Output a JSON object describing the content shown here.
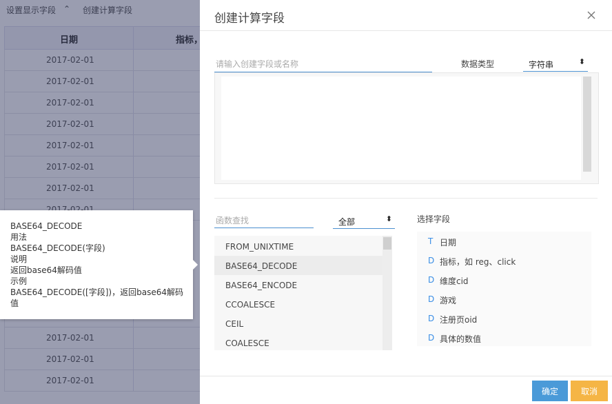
{
  "background": {
    "toolbar": {
      "display_fields": "设置显示字段",
      "chevron": "⌃",
      "create_field": "创建计算字段"
    },
    "table": {
      "headers": [
        "日期",
        "指标，"
      ],
      "rows_top": [
        "2017-02-01",
        "2017-02-01",
        "2017-02-01",
        "2017-02-01",
        "2017-02-01",
        "2017-02-01",
        "2017-02-01",
        "2017-02-01"
      ],
      "rows_bottom": [
        "2017-02-01",
        "2017-02-01",
        "2017-02-01",
        "2017-02-01"
      ]
    }
  },
  "tooltip": {
    "lines": [
      "BASE64_DECODE",
      "用法",
      "BASE64_DECODE(字段)",
      "说明",
      "返回base64解码值",
      "示例",
      "BASE64_DECODE([字段])，返回base64解码",
      "值"
    ]
  },
  "dialog": {
    "title": "创建计算字段",
    "name_placeholder": "请输入创建字段或名称",
    "data_type_label": "数据类型",
    "data_type_value": "字符串",
    "fn_search_placeholder": "函数查找",
    "category_value": "全部",
    "functions": [
      "FROM_UNIXTIME",
      "BASE64_DECODE",
      "BASE64_ENCODE",
      "CCOALESCE",
      "CEIL",
      "COALESCE"
    ],
    "active_function": "BASE64_DECODE",
    "select_field_title": "选择字段",
    "fields": [
      {
        "type": "T",
        "label": "日期"
      },
      {
        "type": "D",
        "label": "指标，如 reg、click"
      },
      {
        "type": "D",
        "label": "维度cid"
      },
      {
        "type": "D",
        "label": "游戏"
      },
      {
        "type": "D",
        "label": "注册页oid"
      },
      {
        "type": "D",
        "label": "具体的数值"
      }
    ],
    "ok_label": "确定",
    "cancel_label": "取消"
  },
  "colors": {
    "accent": "#4a9ad8",
    "cancel": "#f5b545",
    "overlay": "#1e2650"
  }
}
